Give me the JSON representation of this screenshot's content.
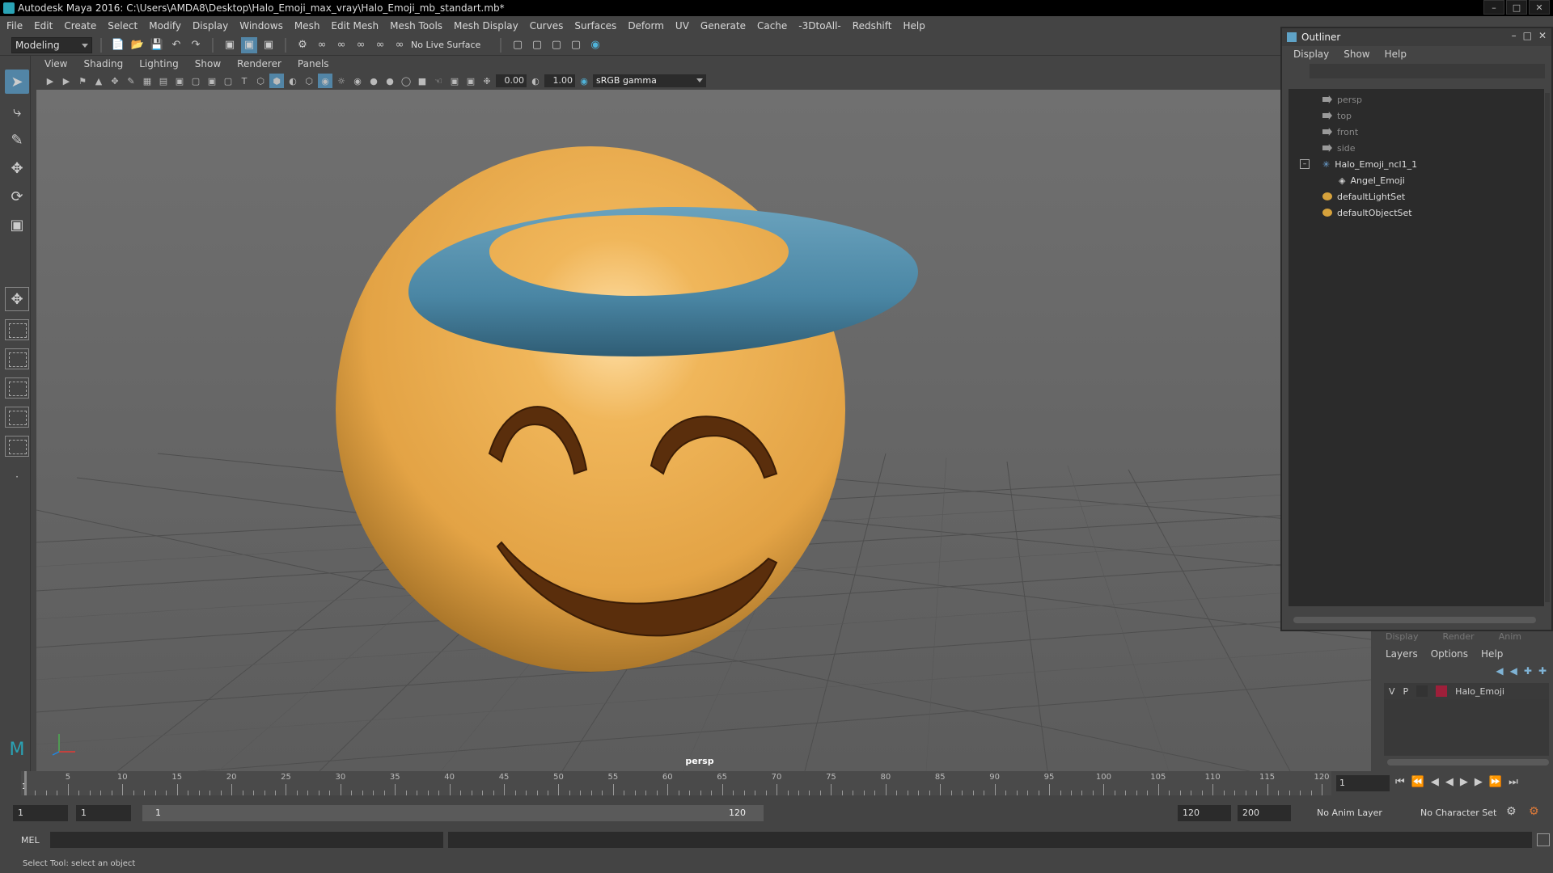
{
  "window": {
    "title": "Autodesk Maya 2016: C:\\Users\\AMDA8\\Desktop\\Halo_Emoji_max_vray\\Halo_Emoji_mb_standart.mb*"
  },
  "menubar": [
    "File",
    "Edit",
    "Create",
    "Select",
    "Modify",
    "Display",
    "Windows",
    "Mesh",
    "Edit Mesh",
    "Mesh Tools",
    "Mesh Display",
    "Curves",
    "Surfaces",
    "Deform",
    "UV",
    "Generate",
    "Cache",
    "-3DtoAll-",
    "Redshift",
    "Help"
  ],
  "shelf": {
    "mode": "Modeling",
    "live_surface": "No Live Surface"
  },
  "viewport": {
    "menu": [
      "View",
      "Shading",
      "Lighting",
      "Show",
      "Renderer",
      "Panels"
    ],
    "exposure": "0.00",
    "gamma_value": "1.00",
    "color_space": "sRGB gamma",
    "camera_label": "persp"
  },
  "outliner": {
    "title": "Outliner",
    "menu": [
      "Display",
      "Show",
      "Help"
    ],
    "items": [
      "persp",
      "top",
      "front",
      "side",
      "Halo_Emoji_ncl1_1",
      "Angel_Emoji",
      "defaultLightSet",
      "defaultObjectSet"
    ]
  },
  "channel_box": {
    "tabs": [
      "Display",
      "Render",
      "Anim"
    ],
    "menu": [
      "Layers",
      "Options",
      "Help"
    ],
    "layer": {
      "v": "V",
      "p": "P",
      "name": "Halo_Emoji",
      "color": "#9e1f3a"
    }
  },
  "timeline": {
    "labels": [
      "1",
      "5",
      "10",
      "15",
      "20",
      "25",
      "30",
      "35",
      "40",
      "45",
      "50",
      "55",
      "60",
      "65",
      "70",
      "75",
      "80",
      "85",
      "90",
      "95",
      "100",
      "105",
      "110",
      "115",
      "120"
    ],
    "current_frame": "1"
  },
  "range": {
    "start": "1",
    "playback_start": "1",
    "slider_start": "1",
    "slider_end": "120",
    "playback_end": "120",
    "end": "200",
    "anim_layer": "No Anim Layer",
    "character_set": "No Character Set"
  },
  "command": {
    "lang": "MEL"
  },
  "help_line": "Select Tool: select an object",
  "colors": {
    "face": "#e9a94a",
    "halo": "#4f8aa8",
    "feature": "#5a2e0c",
    "selection": "#5285a6"
  }
}
